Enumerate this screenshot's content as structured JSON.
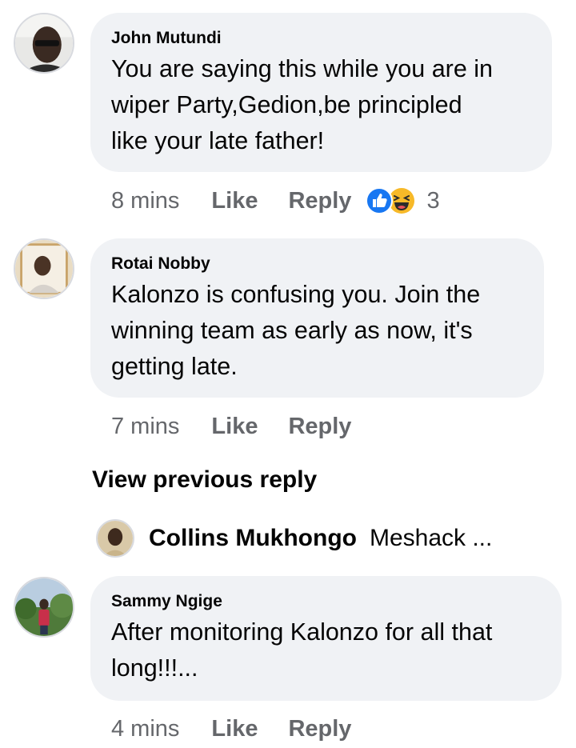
{
  "comments": [
    {
      "author": "John Mutundi",
      "lines": [
        "You are saying this while you are in",
        "wiper Party,Gedion,be principled",
        "like your late father!"
      ],
      "time": "8 mins",
      "like_label": "Like",
      "reply_label": "Reply",
      "reaction_count": "3"
    },
    {
      "author": "Rotai Nobby",
      "lines": [
        "Kalonzo is confusing you. Join the",
        "winning team as early as now, it's",
        "getting late."
      ],
      "time": "7 mins",
      "like_label": "Like",
      "reply_label": "Reply"
    },
    {
      "author": "Sammy Ngige",
      "lines": [
        "After monitoring Kalonzo for all that",
        "long!!!..."
      ],
      "time": "4 mins",
      "like_label": "Like",
      "reply_label": "Reply"
    }
  ],
  "view_previous_reply": "View previous reply",
  "reply_preview": {
    "author": "Collins Mukhongo",
    "text": "Meshack ..."
  },
  "colors": {
    "bubble": "#f0f2f5",
    "meta": "#65676b",
    "like_blue": "#1877f2",
    "haha_yellow": "#f7b928"
  },
  "icons": {
    "like_reaction": "thumbs-up-icon",
    "haha_reaction": "laughing-face-icon"
  }
}
